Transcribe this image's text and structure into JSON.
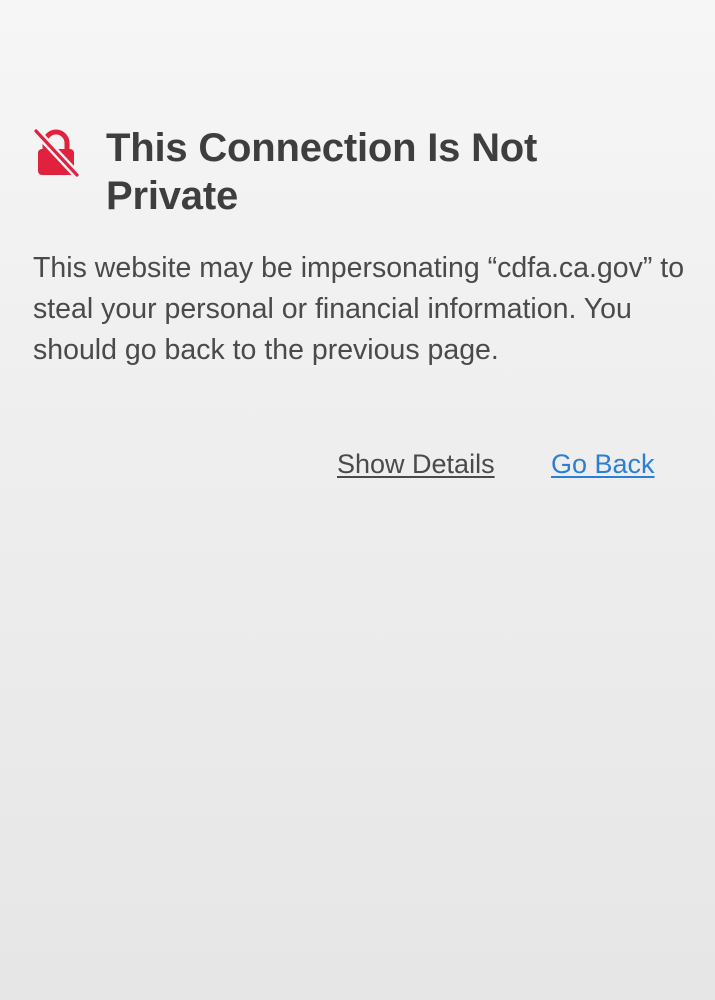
{
  "warning": {
    "title": "This Connection Is Not Private",
    "message": "This website may be impersonating “cdfa.ca.gov” to steal your personal or financial information. You should go back to the previous page.",
    "icon": "lock-slash-icon",
    "icon_color": "#e0223f"
  },
  "actions": {
    "show_details_label": "Show Details",
    "go_back_label": "Go Back",
    "link_color": "#2b7fd4"
  }
}
